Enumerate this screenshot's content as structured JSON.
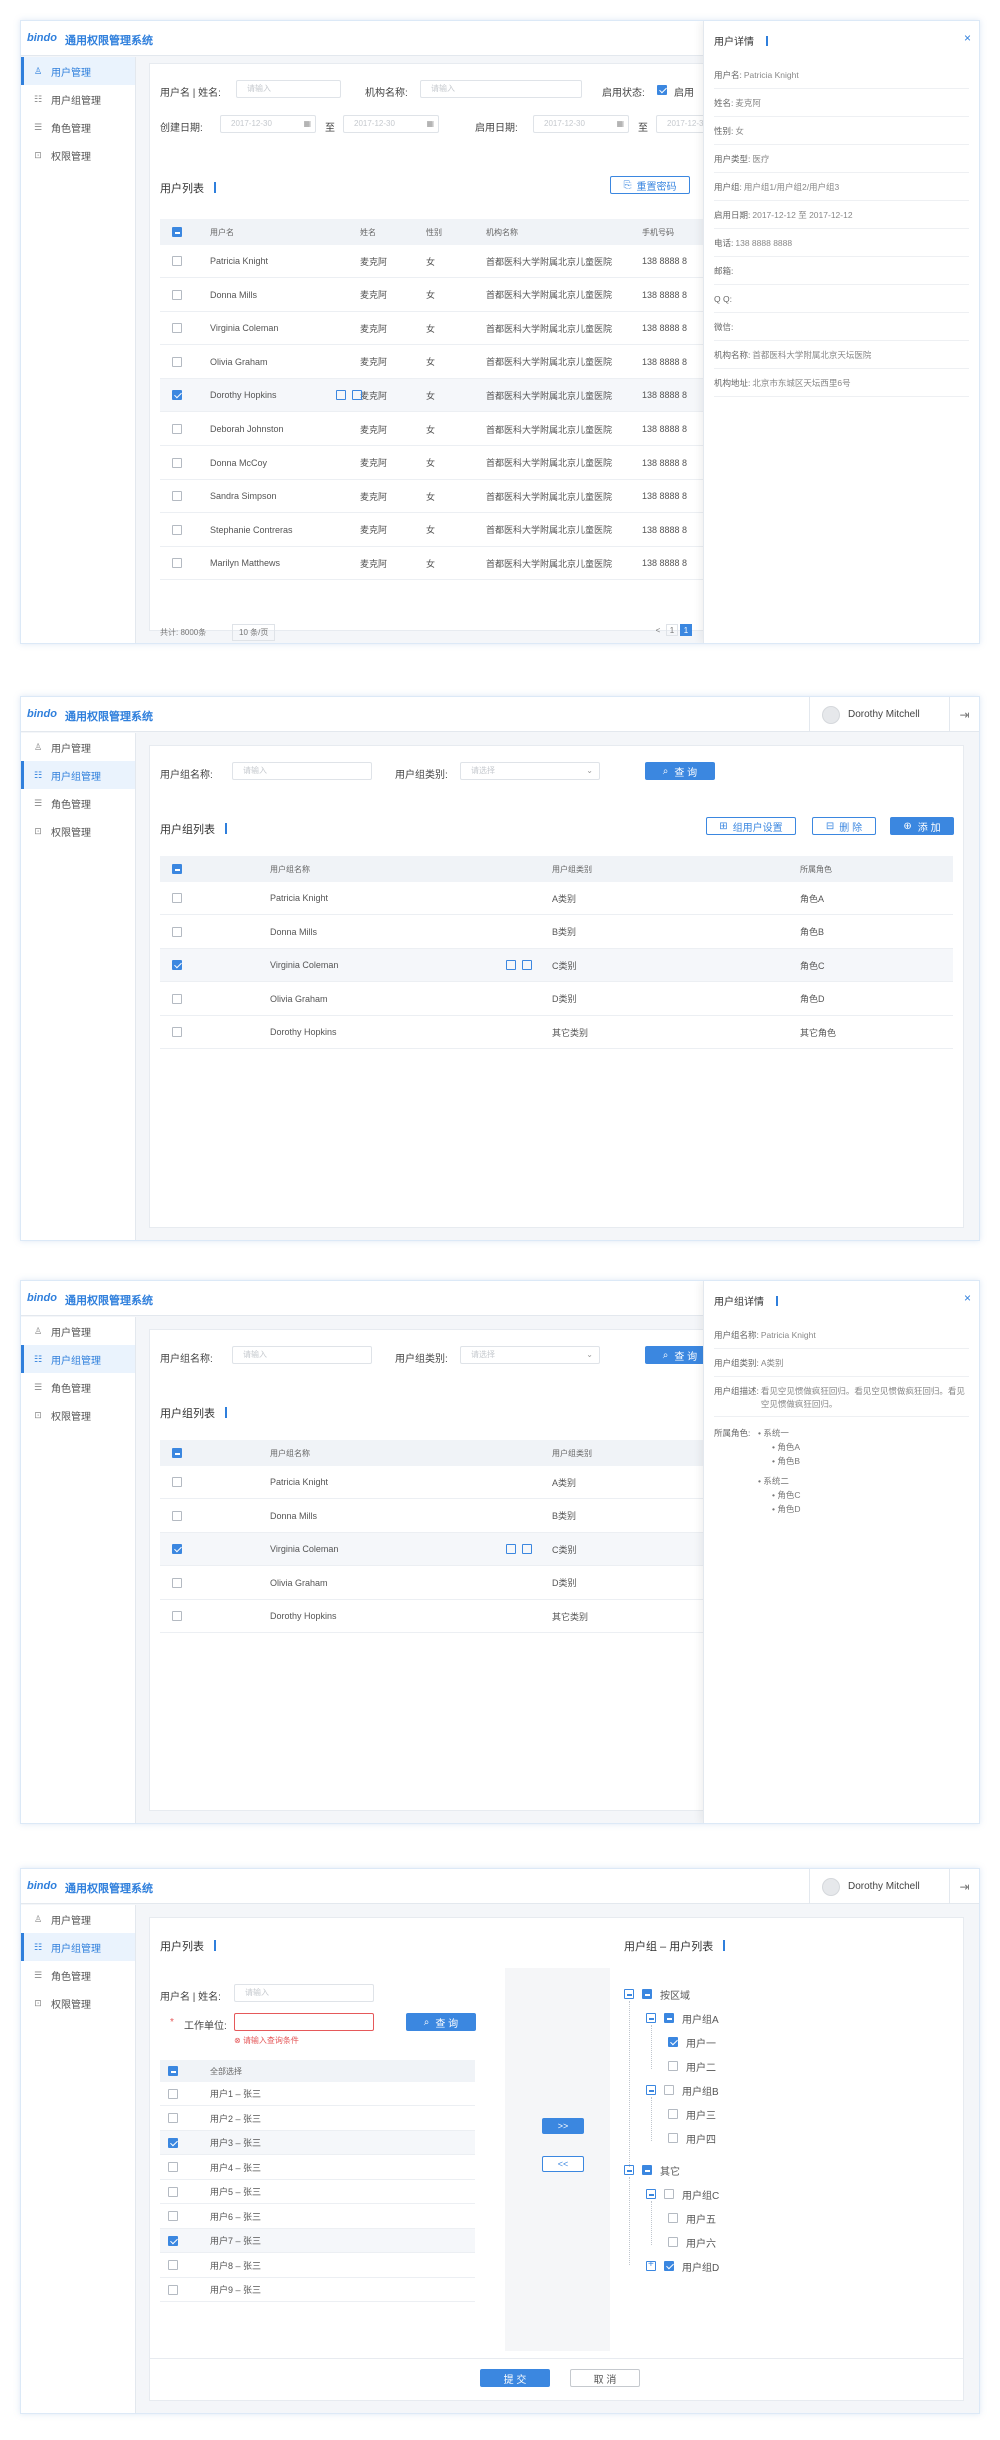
{
  "app": {
    "logo": "bindo",
    "title": "通用权限管理系统"
  },
  "nav": [
    {
      "label": "用户管理"
    },
    {
      "label": "用户组管理"
    },
    {
      "label": "角色管理"
    },
    {
      "label": "权限管理"
    }
  ],
  "current_user": "Dorothy Mitchell",
  "s1": {
    "filters": {
      "name_label": "用户名 | 姓名:",
      "org_label": "机构名称:",
      "status_label": "启用状态:",
      "status_value": "启用",
      "created_label": "创建日期:",
      "to": "至",
      "enabled_label": "启用日期:",
      "placeholder": "请输入",
      "date_placeholder": "2017-12-30"
    },
    "list_title": "用户列表",
    "reset_btn": "重置密码",
    "headers": [
      "用户名",
      "姓名",
      "性别",
      "机构名称",
      "手机号码"
    ],
    "rows": [
      {
        "user": "Patricia Knight",
        "name": "麦克阿",
        "sex": "女",
        "org": "首都医科大学附属北京儿童医院",
        "phone": "138 8888 8"
      },
      {
        "user": "Donna Mills",
        "name": "麦克阿",
        "sex": "女",
        "org": "首都医科大学附属北京儿童医院",
        "phone": "138 8888 8"
      },
      {
        "user": "Virginia Coleman",
        "name": "麦克阿",
        "sex": "女",
        "org": "首都医科大学附属北京儿童医院",
        "phone": "138 8888 8"
      },
      {
        "user": "Olivia Graham",
        "name": "麦克阿",
        "sex": "女",
        "org": "首都医科大学附属北京儿童医院",
        "phone": "138 8888 8"
      },
      {
        "user": "Dorothy Hopkins",
        "name": "麦克阿",
        "sex": "女",
        "org": "首都医科大学附属北京儿童医院",
        "phone": "138 8888 8"
      },
      {
        "user": "Deborah Johnston",
        "name": "麦克阿",
        "sex": "女",
        "org": "首都医科大学附属北京儿童医院",
        "phone": "138 8888 8"
      },
      {
        "user": "Donna McCoy",
        "name": "麦克阿",
        "sex": "女",
        "org": "首都医科大学附属北京儿童医院",
        "phone": "138 8888 8"
      },
      {
        "user": "Sandra Simpson",
        "name": "麦克阿",
        "sex": "女",
        "org": "首都医科大学附属北京儿童医院",
        "phone": "138 8888 8"
      },
      {
        "user": "Stephanie Contreras",
        "name": "麦克阿",
        "sex": "女",
        "org": "首都医科大学附属北京儿童医院",
        "phone": "138 8888 8"
      },
      {
        "user": "Marilyn Matthews",
        "name": "麦克阿",
        "sex": "女",
        "org": "首都医科大学附属北京儿童医院",
        "phone": "138 8888 8"
      }
    ],
    "total": "共计: 8000条",
    "page_size": "10 条/页",
    "pager": [
      "<",
      "1",
      "1"
    ],
    "panel": {
      "title": "用户详情",
      "close": "×",
      "fields": [
        {
          "label": "用户名:",
          "value": "Patricia Knight"
        },
        {
          "label": "姓名:",
          "value": "麦克阿"
        },
        {
          "label": "性别:",
          "value": "女"
        },
        {
          "label": "用户类型:",
          "value": "医疗"
        },
        {
          "label": "用户组:",
          "value": "用户组1/用户组2/用户组3"
        },
        {
          "label": "启用日期:",
          "value": "2017-12-12  至  2017-12-12"
        },
        {
          "label": "电话:",
          "value": "138 8888 8888"
        },
        {
          "label": "邮箱:",
          "value": ""
        },
        {
          "label": "Q Q:",
          "value": ""
        },
        {
          "label": "微信:",
          "value": ""
        },
        {
          "label": "机构名称:",
          "value": "首都医科大学附属北京天坛医院"
        },
        {
          "label": "机构地址:",
          "value": "北京市东城区天坛西里6号"
        }
      ]
    }
  },
  "s2": {
    "group_name_label": "用户组名称:",
    "group_type_label": "用户组类别:",
    "placeholder": "请输入",
    "select_placeholder": "请选择",
    "search_btn": "查 询",
    "list_title": "用户组列表",
    "settings_btn": "组用户设置",
    "delete_btn": "删 除",
    "add_btn": "添 加",
    "headers": [
      "用户组名称",
      "用户组类别",
      "所属角色"
    ],
    "rows": [
      {
        "name": "Patricia Knight",
        "type": "A类别",
        "role": "角色A"
      },
      {
        "name": "Donna Mills",
        "type": "B类别",
        "role": "角色B"
      },
      {
        "name": "Virginia Coleman",
        "type": "C类别",
        "role": "角色C"
      },
      {
        "name": "Olivia Graham",
        "type": "D类别",
        "role": "角色D"
      },
      {
        "name": "Dorothy Hopkins",
        "type": "其它类别",
        "role": "其它角色"
      }
    ]
  },
  "s3": {
    "panel": {
      "title": "用户组详情",
      "close": "×",
      "name_label": "用户组名称:",
      "name_value": "Patricia Knight",
      "type_label": "用户组类别:",
      "type_value": "A类别",
      "desc_label": "用户组描述:",
      "desc_value": "看见空见惯做疯狂回归。看见空见惯做疯狂回归。看见空见惯做疯狂回归。",
      "roles_label": "所属角色:",
      "roles": [
        {
          "system": "系统一",
          "items": [
            "角色A",
            "角色B"
          ]
        },
        {
          "system": "系统二",
          "items": [
            "角色C",
            "角色D"
          ]
        }
      ]
    }
  },
  "s4": {
    "left_title": "用户列表",
    "right_title": "用户组 – 用户列表",
    "name_label": "用户名 | 姓名:",
    "unit_label": "工作单位:",
    "required_mark": "*",
    "placeholder": "请输入",
    "error_msg": "请输入查询条件",
    "search_btn": "查 询",
    "select_all": "全部选择",
    "users": [
      "用户1 – 张三",
      "用户2 – 张三",
      "用户3 – 张三",
      "用户4 – 张三",
      "用户5 – 张三",
      "用户6 – 张三",
      "用户7 – 张三",
      "用户8 – 张三",
      "用户9 – 张三"
    ],
    "move_right": ">>",
    "move_left": "<<",
    "tree": {
      "root1": "按区域",
      "ga": "用户组A",
      "u1": "用户一",
      "u2": "用户二",
      "gb": "用户组B",
      "u3": "用户三",
      "u4": "用户四",
      "root2": "其它",
      "gc": "用户组C",
      "u5": "用户五",
      "u6": "用户六",
      "gd": "用户组D"
    },
    "submit_btn": "提 交",
    "cancel_btn": "取 消"
  }
}
